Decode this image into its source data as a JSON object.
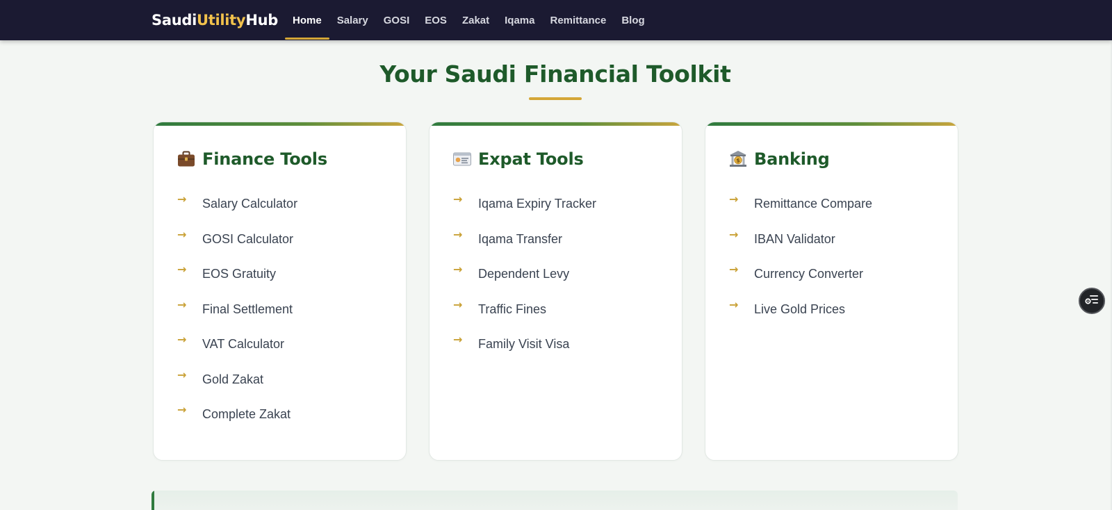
{
  "brand": {
    "part1": "Saudi",
    "part2": "Utility",
    "part3": "Hub"
  },
  "nav": {
    "items": [
      {
        "label": "Home",
        "active": true
      },
      {
        "label": "Salary"
      },
      {
        "label": "GOSI"
      },
      {
        "label": "EOS"
      },
      {
        "label": "Zakat"
      },
      {
        "label": "Iqama"
      },
      {
        "label": "Remittance"
      },
      {
        "label": "Blog"
      }
    ]
  },
  "page": {
    "title": "Your Saudi Financial Toolkit"
  },
  "cards": [
    {
      "title": "Finance Tools",
      "icon": "briefcase-icon",
      "items": [
        "Salary Calculator",
        "GOSI Calculator",
        "EOS Gratuity",
        "Final Settlement",
        "VAT Calculator",
        "Gold Zakat",
        "Complete Zakat"
      ]
    },
    {
      "title": "Expat Tools",
      "icon": "id-card-icon",
      "items": [
        "Iqama Expiry Tracker",
        "Iqama Transfer",
        "Dependent Levy",
        "Traffic Fines",
        "Family Visit Visa"
      ]
    },
    {
      "title": "Banking",
      "icon": "bank-icon",
      "items": [
        "Remittance Compare",
        "IBAN Validator",
        "Currency Converter",
        "Live Gold Prices"
      ]
    }
  ],
  "list_arrow": "→",
  "colors": {
    "navbar_bg": "#1b1a32",
    "brand_accent": "#f2c24c",
    "active_underline": "#d4a637",
    "heading_green": "#1e5a2a",
    "arrow_gold": "#c9a136",
    "page_bg": "#f3f6f3"
  }
}
